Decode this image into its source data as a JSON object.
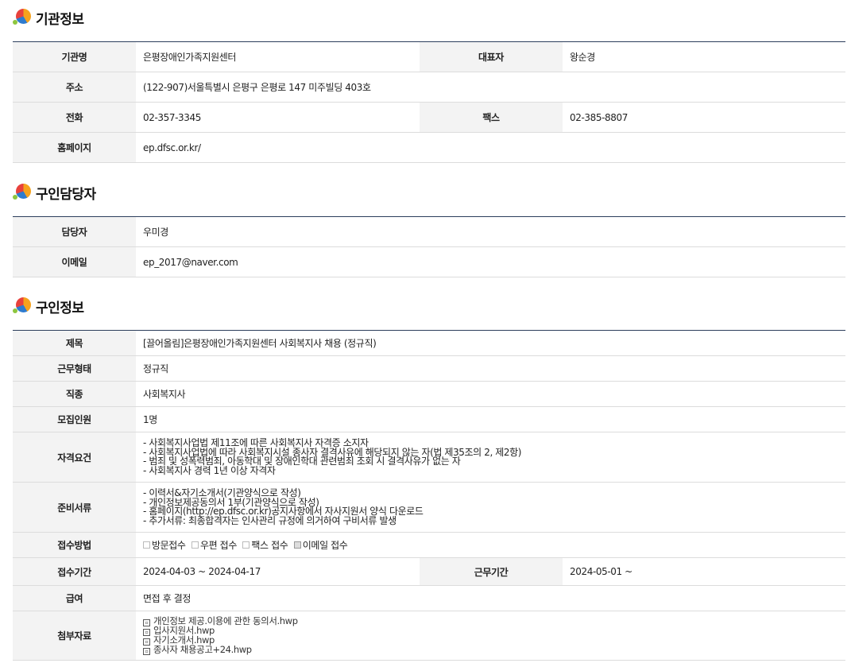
{
  "sections": {
    "org": {
      "title": "기관정보",
      "name_label": "기관명",
      "name": "은평장애인가족지원센터",
      "rep_label": "대표자",
      "rep": "왕순경",
      "addr_label": "주소",
      "addr": "(122-907)서울특별시 은평구 은평로 147 미주빌딩 403호",
      "tel_label": "전화",
      "tel": "02-357-3345",
      "fax_label": "팩스",
      "fax": "02-385-8807",
      "home_label": "홈페이지",
      "home": "ep.dfsc.or.kr/"
    },
    "contact": {
      "title": "구인담당자",
      "person_label": "담당자",
      "person": "우미경",
      "email_label": "이메일",
      "email": "ep_2017@naver.com"
    },
    "job": {
      "title": "구인정보",
      "subject_label": "제목",
      "subject": "[끌어올림]은평장애인가족지원센터 사회복지사 채용 (정규직)",
      "type_label": "근무형태",
      "type": "정규직",
      "kind_label": "직종",
      "kind": "사회복지사",
      "count_label": "모집인원",
      "count": "1명",
      "qual_label": "자격요건",
      "qual": [
        "- 사회복지사업법 제11조에 따른 사회복지사 자격증 소지자",
        "- 사회복지사업법에 따라 사회복지시설 종사자 결격사유에 해당되지 않는 자(법 제35조의 2, 제2항)",
        "- 범죄 및 성폭력범죄, 아동학대 및 장애인학대 관련범죄 조회 시 결격사유가 없는 자",
        "- 사회복지사 경력 1년 이상 자격자"
      ],
      "docs_label": "준비서류",
      "docs": [
        "- 이력서&자기소개서(기관양식으로 작성)",
        "- 개인정보제공동의서 1부(기관양식으로 작성)",
        "- 홈페이지(http://ep.dfsc.or.kr)공지사항에서 자사지원서 양식 다운로드",
        "- 추가서류: 최종합격자는 인사관리 규정에 의거하여 구비서류 발생"
      ],
      "method_label": "접수방법",
      "methods": [
        {
          "label": "방문접수",
          "checked": false
        },
        {
          "label": "우편 접수",
          "checked": false
        },
        {
          "label": "팩스 접수",
          "checked": false
        },
        {
          "label": "이메일 접수",
          "checked": true
        }
      ],
      "period_label": "접수기간",
      "period": "2024-04-03 ~ 2024-04-17",
      "workperiod_label": "근무기간",
      "workperiod": "2024-05-01 ~",
      "pay_label": "급여",
      "pay": "면접 후 결정",
      "files_label": "첨부자료",
      "files": [
        "개인정보 제공.이용에 관한 동의서.hwp",
        "입사지원서.hwp",
        "자기소개서.hwp",
        "종사자 채용공고+24.hwp"
      ]
    }
  }
}
